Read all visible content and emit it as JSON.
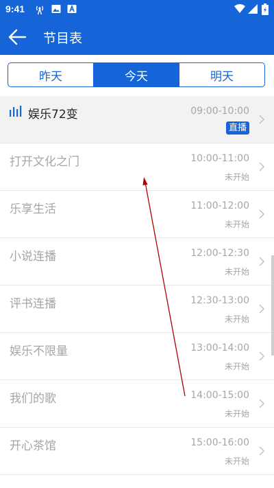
{
  "status_bar": {
    "time": "9:41"
  },
  "header": {
    "title": "节目表"
  },
  "tabs": [
    {
      "label": "昨天"
    },
    {
      "label": "今天"
    },
    {
      "label": "明天"
    }
  ],
  "active_tab": "今天",
  "programs": [
    {
      "title": "娱乐72变",
      "time": "09:00-10:00",
      "status": "直播"
    },
    {
      "title": "打开文化之门",
      "time": "10:00-11:00",
      "status": "未开始"
    },
    {
      "title": "乐享生活",
      "time": "11:00-12:00",
      "status": "未开始"
    },
    {
      "title": "小说连播",
      "time": "12:00-12:30",
      "status": "未开始"
    },
    {
      "title": "评书连播",
      "time": "12:30-13:00",
      "status": "未开始"
    },
    {
      "title": "娱乐不限量",
      "time": "13:00-14:00",
      "status": "未开始"
    },
    {
      "title": "我们的歌",
      "time": "14:00-15:00",
      "status": "未开始"
    },
    {
      "title": "开心茶馆",
      "time": "15:00-16:00",
      "status": "未开始"
    }
  ],
  "colors": {
    "primary": "#1565d8",
    "muted_text": "#a6a6a6",
    "annotation_arrow": "#b00000"
  },
  "icons": [
    "back-arrow-icon",
    "signal-icon",
    "wifi-icon",
    "battery-icon",
    "equalizer-icon",
    "chevron-right-icon"
  ]
}
